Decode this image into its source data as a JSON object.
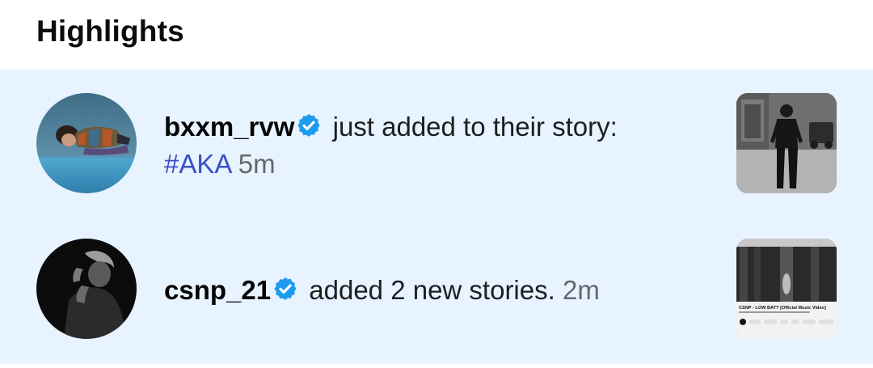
{
  "header": {
    "title": "Highlights"
  },
  "notifications": [
    {
      "username": "bxxm_rvw",
      "action": " just added to their story:",
      "hashtag": "#AKA",
      "time": "5m"
    },
    {
      "username": "csnp_21",
      "action": " added 2 new stories.",
      "time": "2m"
    }
  ],
  "thumbnail_video": {
    "title": "CSNP - LOW BATT [Official Music Video]"
  },
  "colors": {
    "background": "#e7f3ff",
    "verified_badge": "#1d9bf0",
    "hashtag": "#3b4fc4",
    "timestamp": "#65676b"
  },
  "icons": {
    "verified": "verified-badge-icon"
  }
}
